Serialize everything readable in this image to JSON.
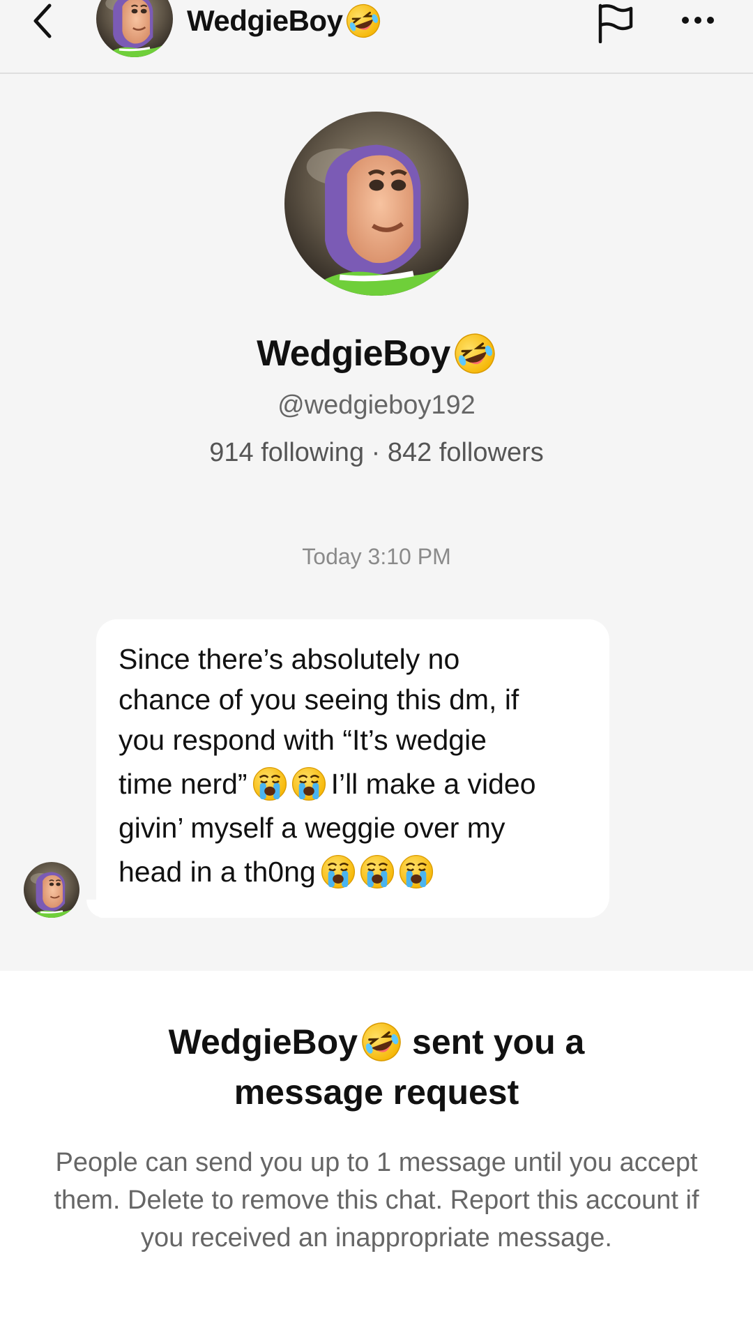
{
  "header": {
    "display_name": "WedgieBoy",
    "name_emoji": "rofl-emoji",
    "icons": [
      "back-chevron-icon",
      "flag-icon",
      "more-dots-icon"
    ]
  },
  "profile": {
    "display_name": "WedgieBoy",
    "handle": "@wedgieboy192",
    "stats": "914 following · 842 followers"
  },
  "conversation": {
    "timestamp": "Today 3:10 PM",
    "message": {
      "line1": "Since there’s absolutely no",
      "line2": "chance of you seeing this dm, if",
      "line3": "you respond with “It’s wedgie",
      "line4a": "time nerd”",
      "line4b": "I’ll make a video",
      "line5": "givin’ myself a weggie over my",
      "line6": "head in a th0ng"
    }
  },
  "request": {
    "title_name": "WedgieBoy",
    "title_rest": "sent you a",
    "title_line2": "message request",
    "body": "People can send you up to 1 message until you accept them. Delete to remove this chat. Report this account if you received an inappropriate message."
  },
  "colors": {
    "background": "#f5f5f5",
    "panel": "#ffffff",
    "muted_text": "#666666",
    "timestamp": "#8a8a8a"
  }
}
